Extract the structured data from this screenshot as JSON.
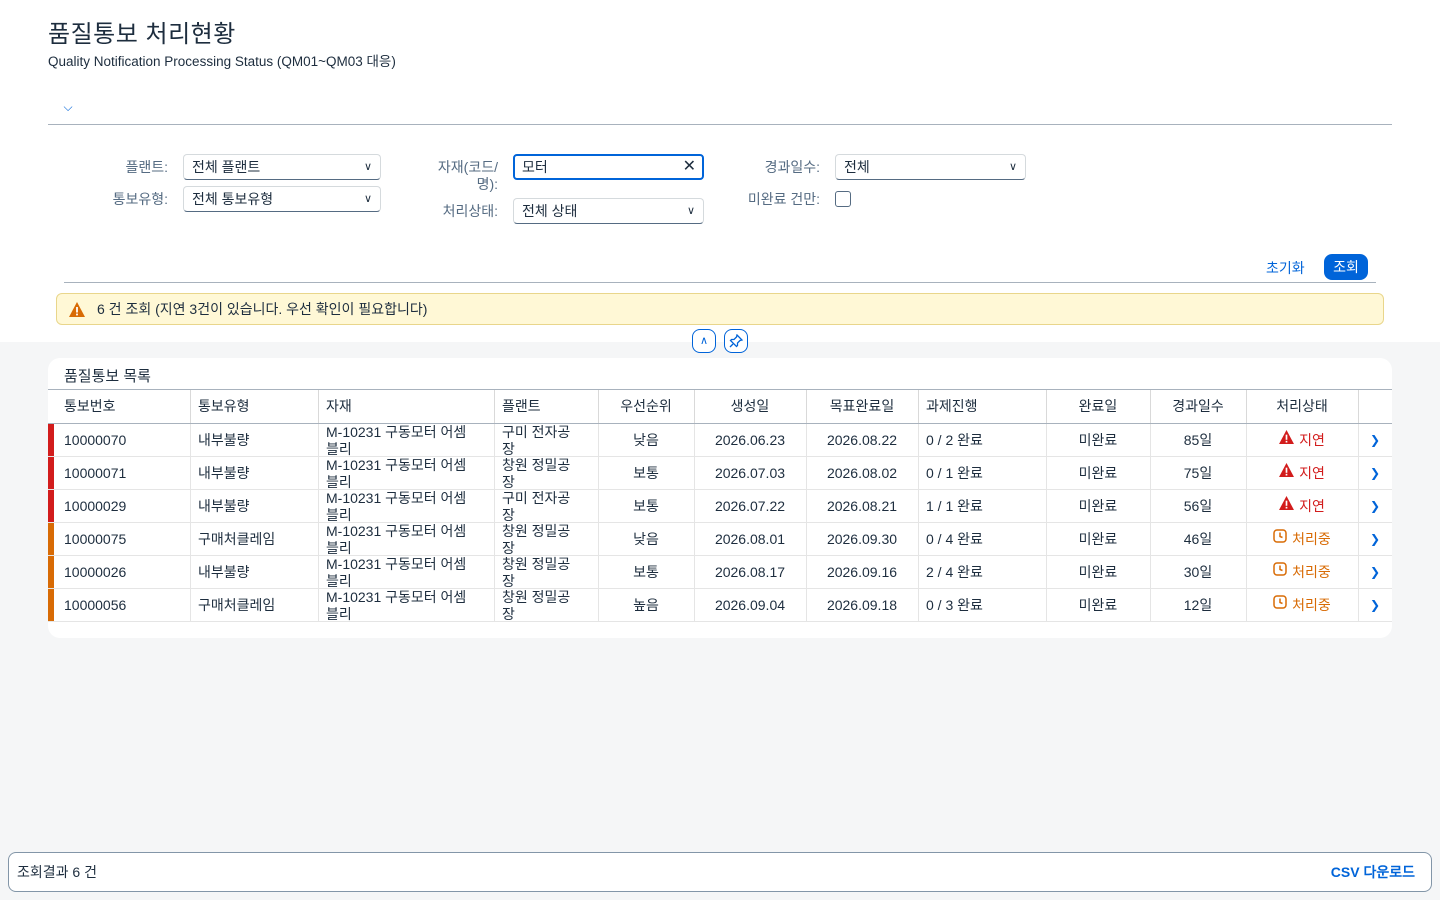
{
  "header": {
    "title": "품질통보 처리현황",
    "subtitle": "Quality Notification Processing Status (QM01~QM03 대응)"
  },
  "filters": {
    "plant_label": "플랜트:",
    "plant_value": "전체 플랜트",
    "notif_type_label": "통보유형:",
    "notif_type_value": "전체 통보유형",
    "material_label_1": "자재(코드/",
    "material_label_2": "명):",
    "material_value": "모터",
    "status_label": "처리상태:",
    "status_value": "전체 상태",
    "elapsed_label": "경과일수:",
    "elapsed_value": "전체",
    "incomplete_label": "미완료 건만:",
    "reset_label": "초기화",
    "search_label": "조회"
  },
  "message": {
    "text": "6 건 조회 (지연 3건이 있습니다. 우선 확인이 필요합니다)"
  },
  "table": {
    "title": "품질통보 목록",
    "columns": [
      "통보번호",
      "통보유형",
      "자재",
      "플랜트",
      "우선순위",
      "생성일",
      "목표완료일",
      "과제진행",
      "완료일",
      "경과일수",
      "처리상태"
    ],
    "rows": [
      {
        "no": "10000070",
        "type": "내부불량",
        "mat1": "M-10231 구동모터 어셈",
        "mat2": "블리",
        "plant1": "구미 전자공",
        "plant2": "장",
        "priority": "낮음",
        "created": "2026.06.23",
        "target": "2026.08.22",
        "tasks": "0 / 2 완료",
        "done": "미완료",
        "elapsed": "85일",
        "status": "지연",
        "level": "error"
      },
      {
        "no": "10000071",
        "type": "내부불량",
        "mat1": "M-10231 구동모터 어셈",
        "mat2": "블리",
        "plant1": "창원 정밀공",
        "plant2": "장",
        "priority": "보통",
        "created": "2026.07.03",
        "target": "2026.08.02",
        "tasks": "0 / 1 완료",
        "done": "미완료",
        "elapsed": "75일",
        "status": "지연",
        "level": "error"
      },
      {
        "no": "10000029",
        "type": "내부불량",
        "mat1": "M-10231 구동모터 어셈",
        "mat2": "블리",
        "plant1": "구미 전자공",
        "plant2": "장",
        "priority": "보통",
        "created": "2026.07.22",
        "target": "2026.08.21",
        "tasks": "1 / 1 완료",
        "done": "미완료",
        "elapsed": "56일",
        "status": "지연",
        "level": "error"
      },
      {
        "no": "10000075",
        "type": "구매처클레임",
        "mat1": "M-10231 구동모터 어셈",
        "mat2": "블리",
        "plant1": "창원 정밀공",
        "plant2": "장",
        "priority": "낮음",
        "created": "2026.08.01",
        "target": "2026.09.30",
        "tasks": "0 / 4 완료",
        "done": "미완료",
        "elapsed": "46일",
        "status": "처리중",
        "level": "warning"
      },
      {
        "no": "10000026",
        "type": "내부불량",
        "mat1": "M-10231 구동모터 어셈",
        "mat2": "블리",
        "plant1": "창원 정밀공",
        "plant2": "장",
        "priority": "보통",
        "created": "2026.08.17",
        "target": "2026.09.16",
        "tasks": "2 / 4 완료",
        "done": "미완료",
        "elapsed": "30일",
        "status": "처리중",
        "level": "warning"
      },
      {
        "no": "10000056",
        "type": "구매처클레임",
        "mat1": "M-10231 구동모터 어셈",
        "mat2": "블리",
        "plant1": "창원 정밀공",
        "plant2": "장",
        "priority": "높음",
        "created": "2026.09.04",
        "target": "2026.09.18",
        "tasks": "0 / 3 완료",
        "done": "미완료",
        "elapsed": "12일",
        "status": "처리중",
        "level": "warning"
      }
    ]
  },
  "footer": {
    "count_text": "조회결과 6 건",
    "csv_label": "CSV 다운로드"
  },
  "colors": {
    "error": "#d21c1c",
    "warning": "#d86b05",
    "accent": "#0064d9"
  }
}
